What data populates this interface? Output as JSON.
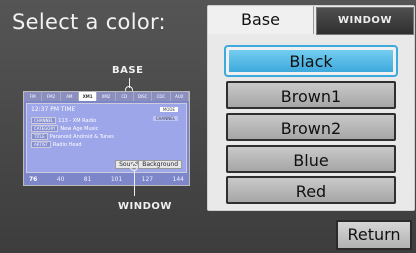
{
  "title": "Select a color:",
  "preview": {
    "base_label": "BASE",
    "window_label": "WINDOW",
    "tabs": [
      "FM",
      "FM2",
      "AM",
      "XM1",
      "XM2",
      "CD",
      "DISC",
      "CDC",
      "AUX"
    ],
    "active_tab": "XM1",
    "time_line": "12:37 PM  TIME",
    "badge_1": "MODE",
    "badge_2": "CHANNEL",
    "channel_tag": "CHANNEL",
    "channel_text": "113 - XM Radio",
    "category_tag": "CATEGORY",
    "category_text": "New Age Music",
    "title_tag": "TITLE",
    "title_text": "Paranoid Android & Tunes",
    "artist_tag": "ARTIST",
    "artist_text": "Radio Head",
    "sound_button": "Sound",
    "background_button": "Background",
    "bottom_labels": [
      "76",
      "40",
      "81",
      "101",
      "127",
      "144"
    ]
  },
  "panel": {
    "tab_base": "Base",
    "tab_window": "WINDOW",
    "colors": [
      "Black",
      "Brown1",
      "Brown2",
      "Blue",
      "Red"
    ],
    "selected": "Black"
  },
  "return_label": "Return",
  "accent_color": "#3da9dc"
}
